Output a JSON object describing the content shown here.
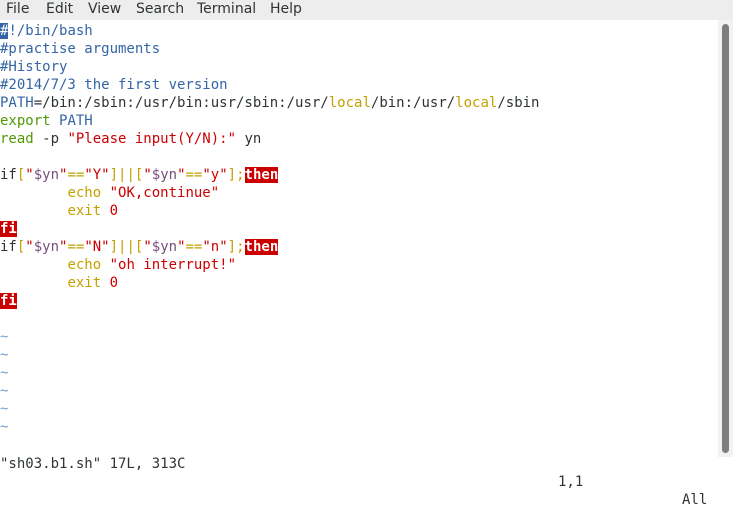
{
  "menu": [
    "File",
    "Edit",
    "View",
    "Search",
    "Terminal",
    "Help"
  ],
  "code": [
    [
      [
        "#",
        "cursor"
      ],
      [
        "!/bin/bash",
        "comment"
      ]
    ],
    [
      [
        "#practise arguments",
        "comment"
      ]
    ],
    [
      [
        "#History",
        "comment"
      ]
    ],
    [
      [
        "#2014/7/3 the first version",
        "comment"
      ]
    ],
    [
      [
        "PATH",
        "comment"
      ],
      [
        "=/bin:/sbin:/usr/bin:usr/sbin:/usr/",
        ""
      ],
      [
        "local",
        "olive"
      ],
      [
        "/bin:/usr/",
        ""
      ],
      [
        "local",
        "olive"
      ],
      [
        "/sbin",
        ""
      ]
    ],
    [
      [
        "export",
        "green"
      ],
      [
        " ",
        ""
      ],
      [
        "PATH",
        "comment"
      ]
    ],
    [
      [
        "read",
        "green"
      ],
      [
        " -p ",
        ""
      ],
      [
        "\"Please input(Y/N):\"",
        "red"
      ],
      [
        " yn",
        ""
      ]
    ],
    [],
    [
      [
        "if",
        ""
      ],
      [
        "[",
        "olive"
      ],
      [
        "\"",
        "red"
      ],
      [
        "$yn",
        "purple"
      ],
      [
        "\"",
        "red"
      ],
      [
        "==",
        "olive"
      ],
      [
        "\"Y\"",
        "red"
      ],
      [
        "]||[",
        "olive"
      ],
      [
        "\"",
        "red"
      ],
      [
        "$yn",
        "purple"
      ],
      [
        "\"",
        "red"
      ],
      [
        "==",
        "olive"
      ],
      [
        "\"y\"",
        "red"
      ],
      [
        "];",
        "olive"
      ],
      [
        "then",
        "kwhl"
      ]
    ],
    [
      [
        "        ",
        ""
      ],
      [
        "echo",
        "olive"
      ],
      [
        " ",
        ""
      ],
      [
        "\"OK,continue\"",
        "red"
      ]
    ],
    [
      [
        "        ",
        ""
      ],
      [
        "exit",
        "olive"
      ],
      [
        " ",
        ""
      ],
      [
        "0",
        "red"
      ]
    ],
    [
      [
        "fi",
        "kwhl"
      ]
    ],
    [
      [
        "if",
        ""
      ],
      [
        "[",
        "olive"
      ],
      [
        "\"",
        "red"
      ],
      [
        "$yn",
        "purple"
      ],
      [
        "\"",
        "red"
      ],
      [
        "==",
        "olive"
      ],
      [
        "\"N\"",
        "red"
      ],
      [
        "]||[",
        "olive"
      ],
      [
        "\"",
        "red"
      ],
      [
        "$yn",
        "purple"
      ],
      [
        "\"",
        "red"
      ],
      [
        "==",
        "olive"
      ],
      [
        "\"n\"",
        "red"
      ],
      [
        "];",
        "olive"
      ],
      [
        "then",
        "kwhl"
      ]
    ],
    [
      [
        "        ",
        ""
      ],
      [
        "echo",
        "olive"
      ],
      [
        " ",
        ""
      ],
      [
        "\"oh interrupt!\"",
        "red"
      ]
    ],
    [
      [
        "        ",
        ""
      ],
      [
        "exit",
        "olive"
      ],
      [
        " ",
        ""
      ],
      [
        "0",
        "red"
      ]
    ],
    [
      [
        "fi",
        "kwhl"
      ]
    ],
    [],
    [
      [
        "~",
        "tilde"
      ]
    ],
    [
      [
        "~",
        "tilde"
      ]
    ],
    [
      [
        "~",
        "tilde"
      ]
    ],
    [
      [
        "~",
        "tilde"
      ]
    ],
    [
      [
        "~",
        "tilde"
      ]
    ],
    [
      [
        "~",
        "tilde"
      ]
    ]
  ],
  "status": {
    "file": "\"sh03.b1.sh\" 17L, 313C",
    "position": "1,1",
    "scroll": "All"
  }
}
